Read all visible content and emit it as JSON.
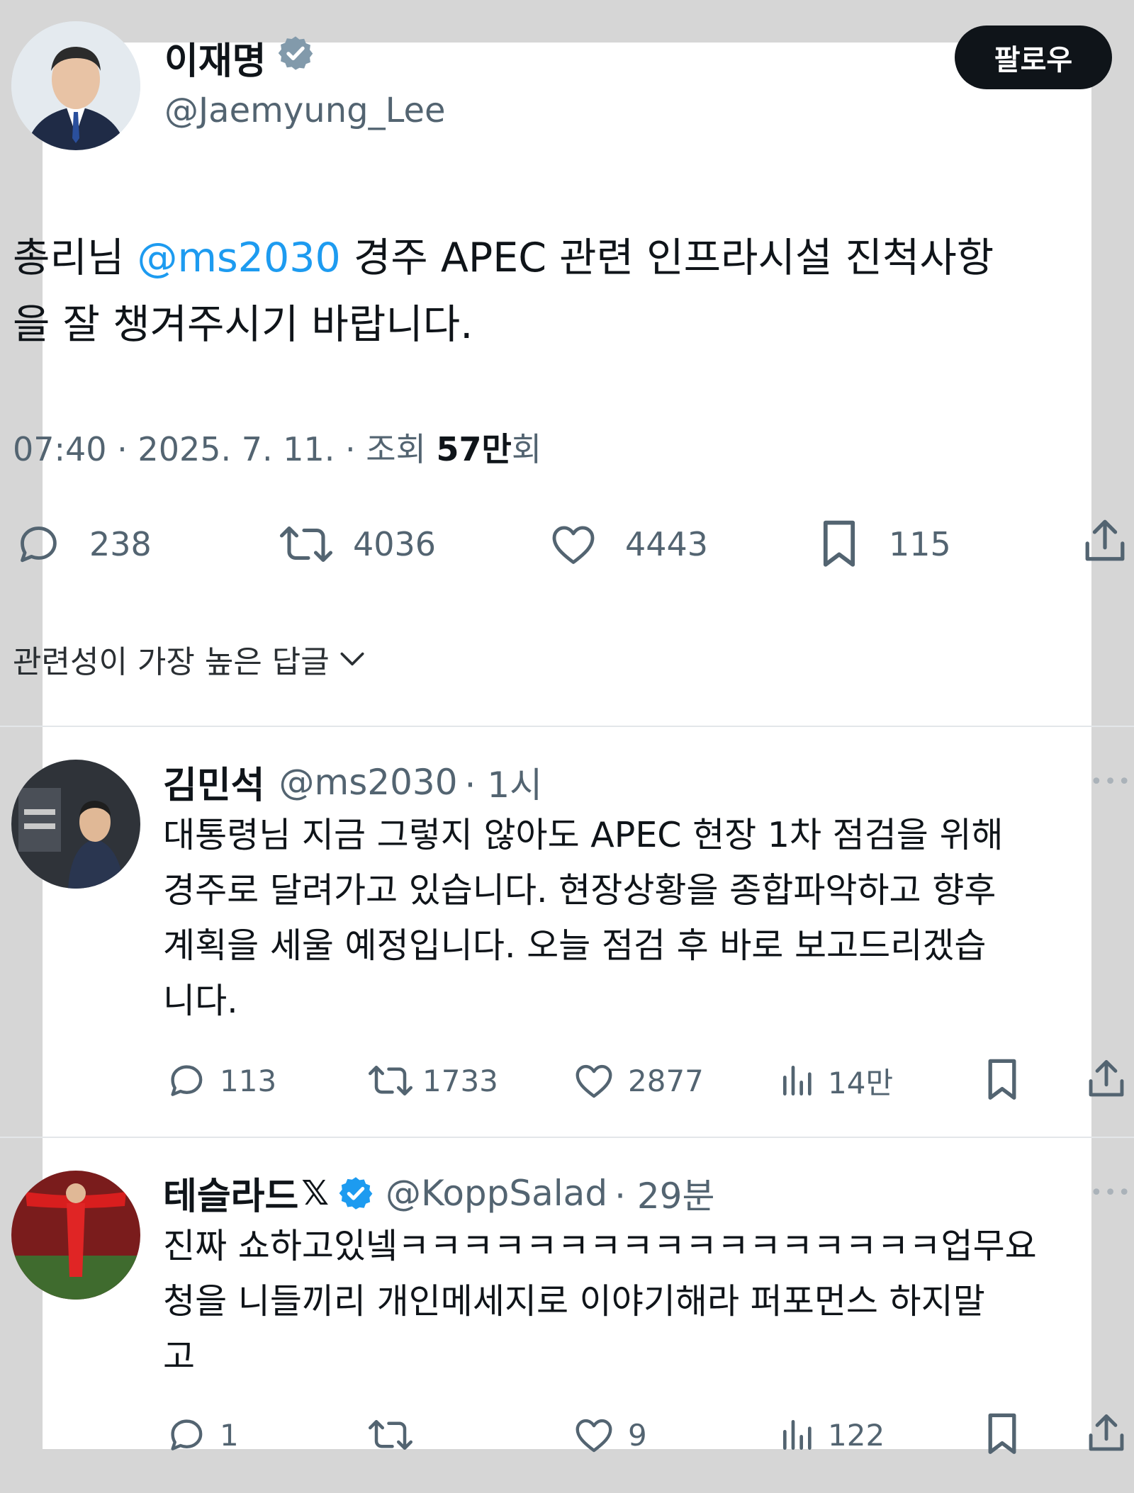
{
  "main_tweet": {
    "author_name": "이재명",
    "author_handle": "@Jaemyung_Lee",
    "follow_label": "팔로우",
    "text_prefix": "총리님 ",
    "mention": "@ms2030",
    "text_line1_rest": " 경주 APEC 관련 인프라시설 진척사항",
    "text_line2": "을 잘 챙겨주시기 바랍니다.",
    "meta_prefix": "07:40 · 2025. 7. 11. · 조회 ",
    "views_bold": "57만",
    "views_suffix": "회",
    "stats": {
      "replies": "238",
      "reposts": "4036",
      "likes": "4443",
      "bookmarks": "115"
    }
  },
  "sort_label": "관련성이 가장 높은 답글",
  "replies": [
    {
      "author_name": "김민석",
      "author_handle": "@ms2030",
      "time": "· 1시",
      "lines": [
        "대통령님 지금 그렇지 않아도 APEC 현장 1차 점검을 위해",
        "경주로 달려가고 있습니다. 현장상황을 종합파악하고 향후",
        "계획을 세울 예정입니다. 오늘 점검 후 바로 보고드리겠습",
        "니다."
      ],
      "stats": {
        "replies": "113",
        "reposts": "1733",
        "likes": "2877",
        "views": "14만"
      }
    },
    {
      "author_name": "테슬라드",
      "author_handle": "@KoppSalad",
      "time": "· 29분",
      "lines": [
        "진짜 쇼하고있넼ㅋㅋㅋㅋㅋㅋㅋㅋㅋㅋㅋㅋㅋㅋㅋㅋㅋ업무요",
        "청을 니들끼리 개인메세지로 이야기해라 퍼포먼스 하지말",
        "고"
      ],
      "stats": {
        "replies": "1",
        "reposts": "",
        "likes": "9",
        "views": "122"
      }
    }
  ],
  "colors": {
    "accent": "#1d9bf0",
    "text": "#0f1419",
    "muted": "#536471",
    "follow_bg": "#0f1419"
  }
}
